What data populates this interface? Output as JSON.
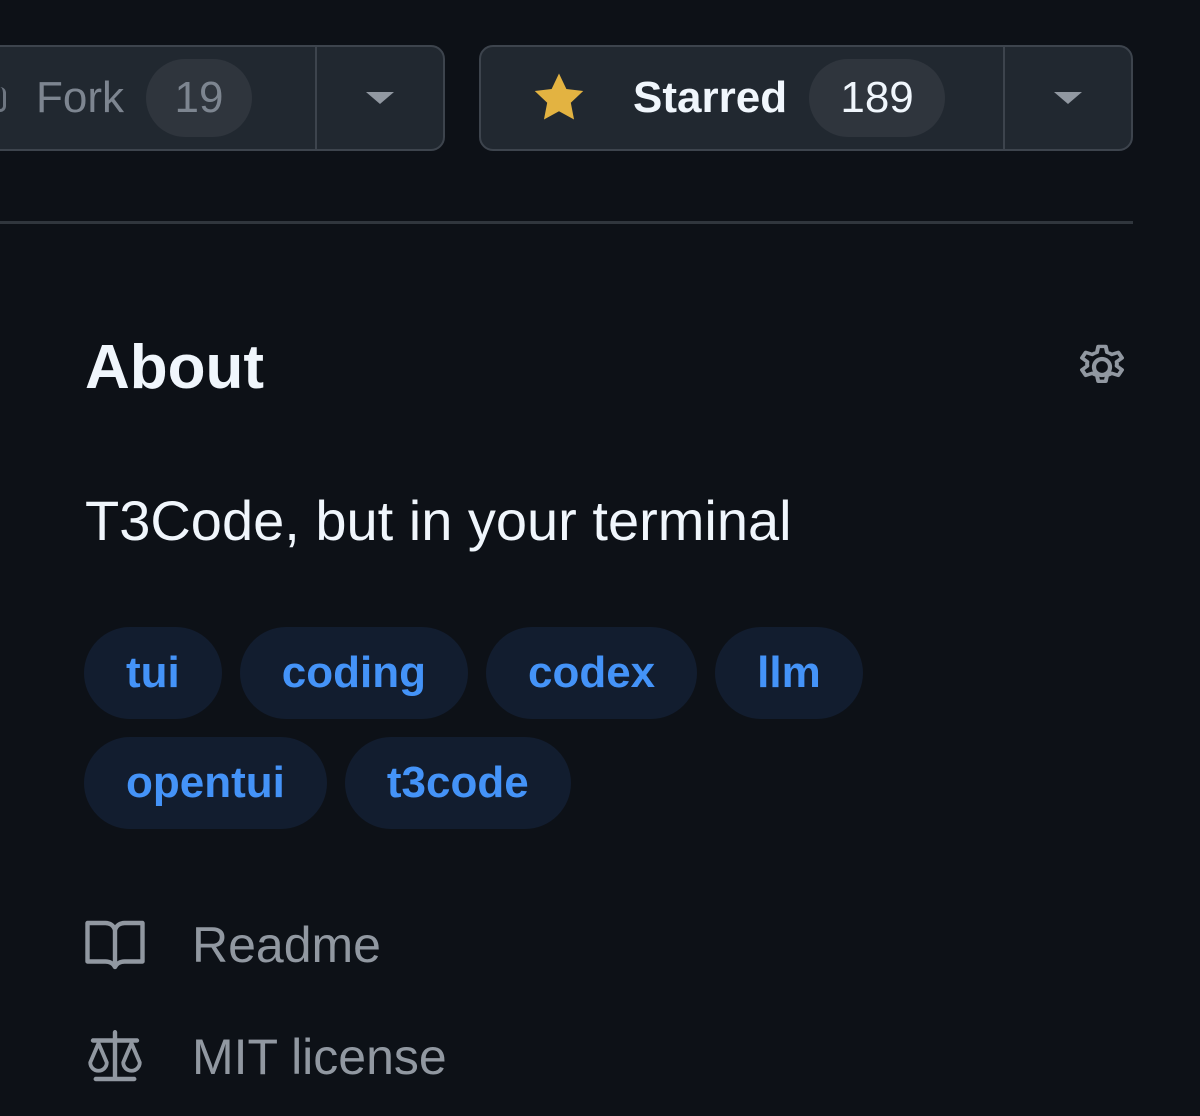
{
  "repo_actions": {
    "fork": {
      "label": "Fork",
      "count": "19",
      "icon": "fork-icon"
    },
    "star": {
      "label": "Starred",
      "count": "189",
      "icon": "star-icon",
      "star_color": "#e3b341"
    }
  },
  "about": {
    "title": "About",
    "description": "T3Code, but in your terminal",
    "topics": [
      "tui",
      "coding",
      "codex",
      "llm",
      "opentui",
      "t3code"
    ],
    "links": [
      {
        "label": "Readme",
        "icon": "book-icon"
      },
      {
        "label": "MIT license",
        "icon": "law-icon"
      }
    ]
  },
  "colors": {
    "background": "#0d1117",
    "topic_bg": "#121d2f",
    "topic_fg": "#4493f8",
    "muted": "#9198a1"
  }
}
